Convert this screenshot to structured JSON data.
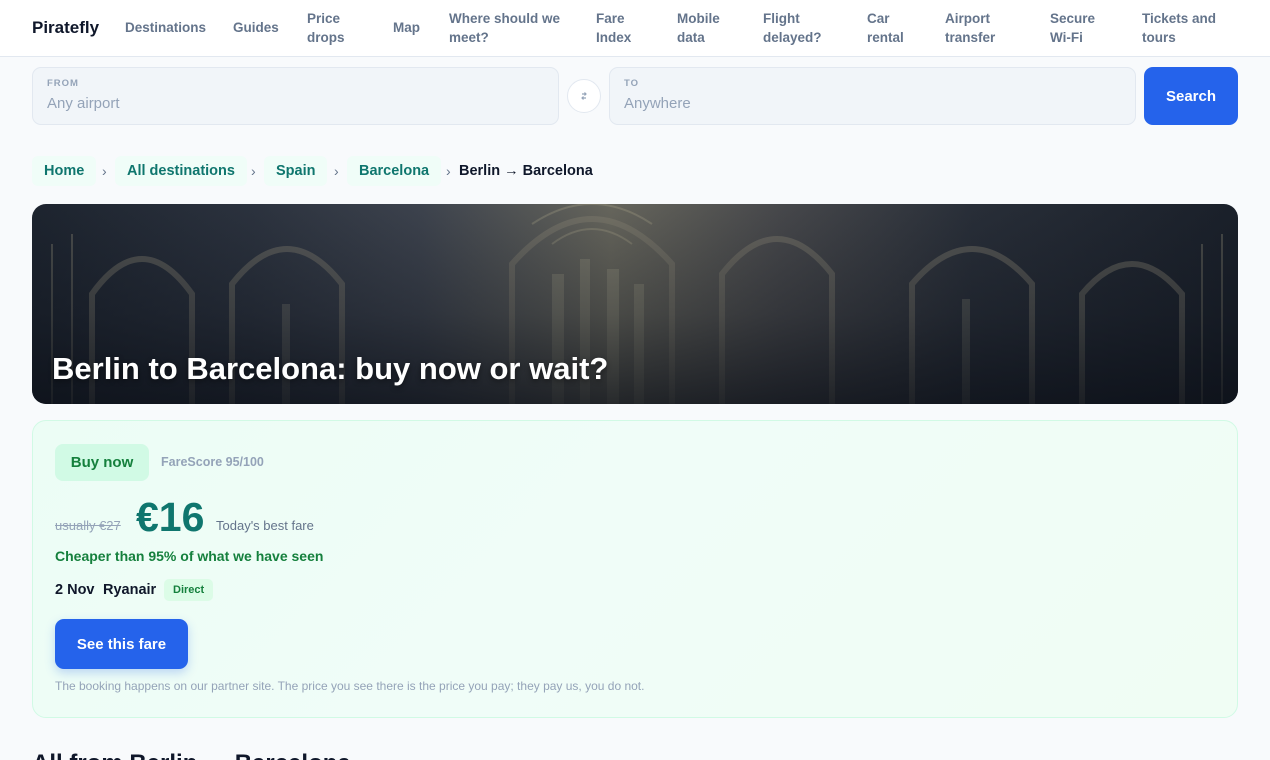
{
  "brand": "Piratefly",
  "nav": {
    "items": [
      {
        "id": "destinations",
        "line1": "Destinations",
        "line2": ""
      },
      {
        "id": "guides",
        "line1": "Guides",
        "line2": ""
      },
      {
        "id": "price-drops",
        "line1": "Price",
        "line2": "drops"
      },
      {
        "id": "map",
        "line1": "Map",
        "line2": ""
      },
      {
        "id": "where-meet",
        "line1": "Where should we",
        "line2": "meet?"
      },
      {
        "id": "fare-index",
        "line1": "Fare",
        "line2": "Index"
      },
      {
        "id": "mobile-data",
        "line1": "Mobile",
        "line2": "data"
      },
      {
        "id": "flight-delayed",
        "line1": "Flight",
        "line2": "delayed?"
      },
      {
        "id": "car-rental",
        "line1": "Car",
        "line2": "rental"
      },
      {
        "id": "airport-transfer",
        "line1": "Airport",
        "line2": "transfer"
      },
      {
        "id": "secure-wifi",
        "line1": "Secure",
        "line2": "Wi-Fi"
      },
      {
        "id": "tickets-tours",
        "line1": "Tickets and",
        "line2": "tours"
      }
    ]
  },
  "search": {
    "from_label": "FROM",
    "from_placeholder": "Any airport",
    "from_value": "",
    "to_label": "TO",
    "to_placeholder": "Anywhere",
    "to_value": "",
    "swap_icon": "swap-icon",
    "button_label": "Search"
  },
  "breadcrumb": {
    "items": [
      "Home",
      "All destinations",
      "Spain",
      "Barcelona"
    ],
    "separator": "›",
    "current": "Berlin → Barcelona"
  },
  "hero": {
    "title": "Berlin to Barcelona: buy now or wait?"
  },
  "fare": {
    "verdict": "Buy now",
    "score": "FareScore 95/100",
    "usual_price": "usually €27",
    "price": "€16",
    "price_note": "Today's best fare",
    "cheaper_text": "Cheaper than 95% of what we have seen",
    "date": "2 Nov",
    "airline": "Ryanair",
    "direct_badge": "Direct",
    "cta_label": "See this fare",
    "disclaimer": "The booking happens on our partner site. The price you see there is the price you pay; they pay us, you do not."
  },
  "next_section_heading": "All from Berlin → Barcelona",
  "colors": {
    "accent": "#2563eb",
    "brand_teal": "#0f766e",
    "success": "#15803d"
  }
}
